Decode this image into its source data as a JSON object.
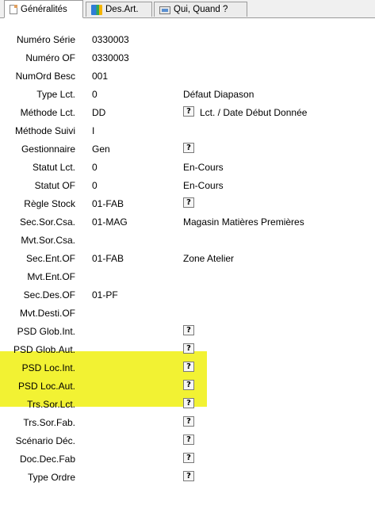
{
  "tabs": [
    {
      "label": "Généralités",
      "icon": "document-icon",
      "active": true
    },
    {
      "label": "Des.Art.",
      "icon": "book-icon",
      "active": false
    },
    {
      "label": "Qui, Quand ?",
      "icon": "screenshot-icon",
      "active": false
    }
  ],
  "fields": [
    {
      "label": "Numéro Série",
      "value": "0330003"
    },
    {
      "label": "Numéro OF",
      "value": "0330003"
    },
    {
      "label": "NumOrd Besc",
      "value": "001"
    },
    {
      "label": "Type Lct.",
      "value": "0",
      "desc": "Défaut Diapason"
    },
    {
      "label": "Méthode Lct.",
      "value": "DD",
      "help": "?",
      "desc": "Lct. / Date Début Donnée"
    },
    {
      "label": "Méthode Suivi",
      "value": "I"
    },
    {
      "label": "Gestionnaire",
      "value": "Gen",
      "help": "?"
    },
    {
      "label": "Statut Lct.",
      "value": "0",
      "desc": "En-Cours"
    },
    {
      "label": "Statut OF",
      "value": "0",
      "desc": "En-Cours"
    },
    {
      "label": "Règle Stock",
      "value": "01-FAB",
      "help": "?"
    },
    {
      "label": "Sec.Sor.Csa.",
      "value": "01-MAG",
      "desc": "Magasin Matières Premières"
    },
    {
      "label": "Mvt.Sor.Csa.",
      "value": ""
    },
    {
      "label": "Sec.Ent.OF",
      "value": "01-FAB",
      "desc": "Zone Atelier"
    },
    {
      "label": "Mvt.Ent.OF",
      "value": ""
    },
    {
      "label": "Sec.Des.OF",
      "value": "01-PF"
    },
    {
      "label": "Mvt.Desti.OF",
      "value": ""
    },
    {
      "label": "PSD Glob.Int.",
      "value": "",
      "help": "?"
    },
    {
      "label": "PSD Glob.Aut.",
      "value": "",
      "help": "?"
    },
    {
      "label": "PSD Loc.Int.",
      "value": "",
      "help": "?"
    },
    {
      "label": "PSD Loc.Aut.",
      "value": "",
      "help": "?"
    },
    {
      "label": "Trs.Sor.Lct.",
      "value": "",
      "help": "?"
    },
    {
      "label": "Trs.Sor.Fab.",
      "value": "",
      "help": "?"
    },
    {
      "label": "Scénario Déc.",
      "value": "",
      "help": "?"
    },
    {
      "label": "Doc.Dec.Fab",
      "value": "",
      "help": "?"
    },
    {
      "label": "Type Ordre",
      "value": "",
      "help": "?"
    }
  ],
  "highlight_color": "#f2f233"
}
